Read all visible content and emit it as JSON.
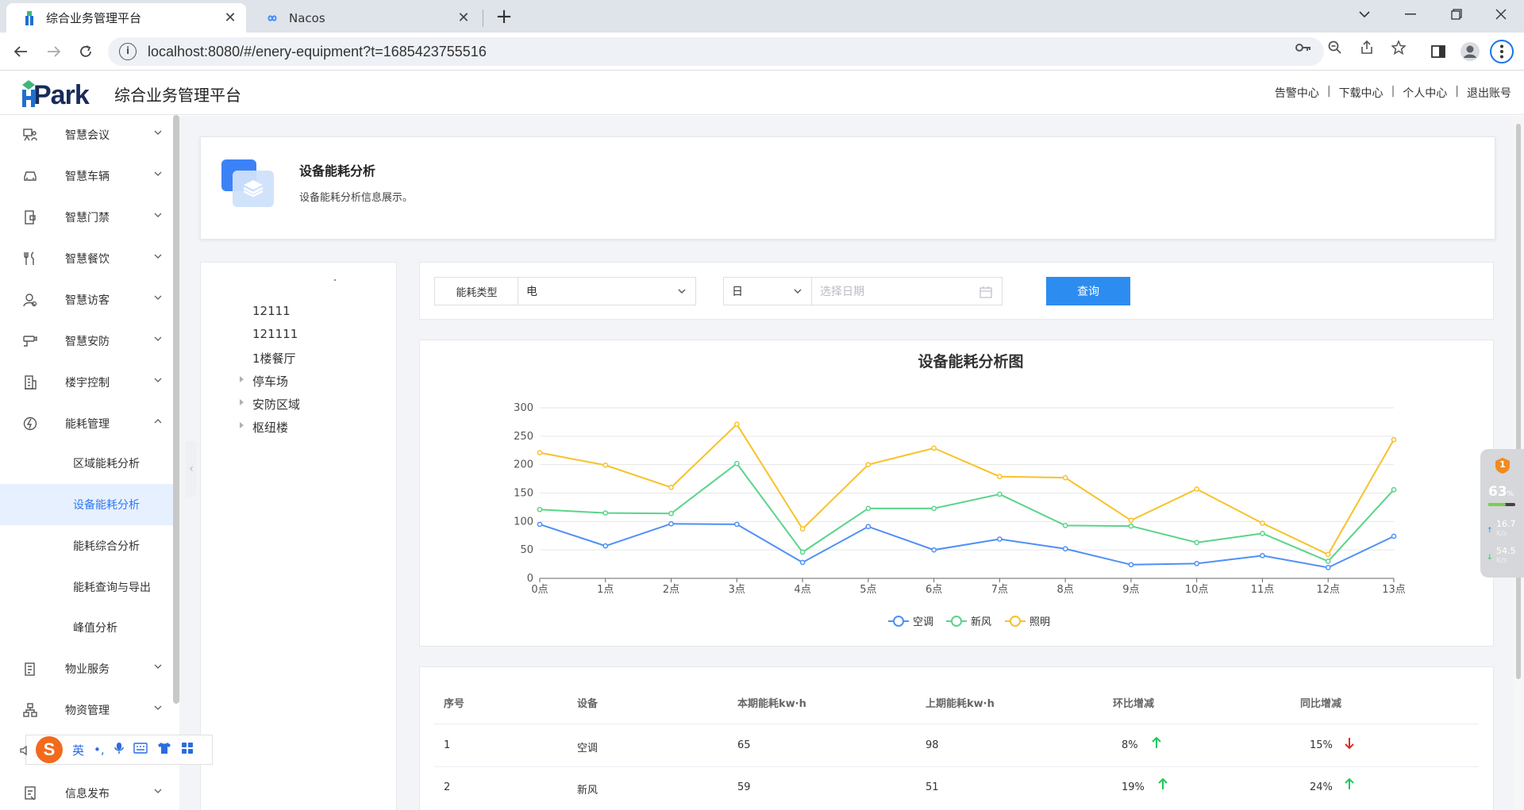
{
  "browser": {
    "tabs": [
      {
        "title": "综合业务管理平台",
        "active": true
      },
      {
        "title": "Nacos",
        "active": false
      }
    ],
    "url": "localhost:8080/#/enery-equipment?t=1685423755516"
  },
  "app": {
    "logo_text": "Park",
    "title": "综合业务管理平台",
    "top_links": [
      "告警中心",
      "下载中心",
      "个人中心",
      "退出账号"
    ]
  },
  "sidebar": {
    "items": [
      {
        "label": "智慧会议",
        "icon": "meeting-icon"
      },
      {
        "label": "智慧车辆",
        "icon": "car-icon"
      },
      {
        "label": "智慧门禁",
        "icon": "door-icon"
      },
      {
        "label": "智慧餐饮",
        "icon": "dining-icon"
      },
      {
        "label": "智慧访客",
        "icon": "visitor-icon"
      },
      {
        "label": "智慧安防",
        "icon": "camera-icon"
      },
      {
        "label": "楼宇控制",
        "icon": "building-icon"
      },
      {
        "label": "能耗管理",
        "icon": "energy-icon",
        "expanded": true
      }
    ],
    "sub_items": [
      {
        "label": "区域能耗分析",
        "active": false
      },
      {
        "label": "设备能耗分析",
        "active": true
      },
      {
        "label": "能耗综合分析",
        "active": false
      },
      {
        "label": "能耗查询与导出",
        "active": false
      },
      {
        "label": "峰值分析",
        "active": false
      }
    ],
    "items_after": [
      {
        "label": "物业服务",
        "icon": "property-icon"
      },
      {
        "label": "物资管理",
        "icon": "material-icon"
      },
      {
        "label": "信息发布",
        "icon": "publish-icon"
      }
    ]
  },
  "intro": {
    "title": "设备能耗分析",
    "description": "设备能耗分析信息展示。"
  },
  "tree": {
    "nodes": [
      {
        "label": "12111",
        "expandable": false
      },
      {
        "label": "121111",
        "expandable": false
      },
      {
        "label": "1楼餐厅",
        "expandable": false
      },
      {
        "label": "停车场",
        "expandable": true
      },
      {
        "label": "安防区域",
        "expandable": true
      },
      {
        "label": "枢纽楼",
        "expandable": true
      }
    ]
  },
  "filters": {
    "type_label": "能耗类型",
    "type_value": "电",
    "period_value": "日",
    "date_placeholder": "选择日期",
    "query_label": "查询"
  },
  "chart_data": {
    "type": "line",
    "title": "设备能耗分析图",
    "categories": [
      "0点",
      "1点",
      "2点",
      "3点",
      "4点",
      "5点",
      "6点",
      "7点",
      "8点",
      "9点",
      "10点",
      "11点",
      "12点",
      "13点"
    ],
    "series": [
      {
        "name": "空调",
        "color": "#4f8ff7",
        "values": [
          95,
          57,
          96,
          95,
          28,
          91,
          50,
          69,
          52,
          24,
          26,
          40,
          19,
          74
        ]
      },
      {
        "name": "新风",
        "color": "#5ad48a",
        "values": [
          121,
          115,
          114,
          202,
          46,
          123,
          123,
          148,
          93,
          92,
          63,
          79,
          30,
          156
        ]
      },
      {
        "name": "照明",
        "color": "#f7c22a",
        "values": [
          221,
          199,
          160,
          271,
          87,
          200,
          229,
          179,
          177,
          102,
          157,
          97,
          42,
          244
        ]
      }
    ],
    "ylim": [
      0,
      300
    ],
    "yticks": [
      0,
      50,
      100,
      150,
      200,
      250,
      300
    ],
    "grid": true,
    "legend_position": "bottom"
  },
  "table": {
    "headers": [
      "序号",
      "设备",
      "本期能耗kw·h",
      "上期能耗kw·h",
      "环比增减",
      "同比增减"
    ],
    "rows": [
      {
        "idx": "1",
        "device": "空调",
        "current": "65",
        "previous": "98",
        "mom": "8%",
        "mom_dir": "up",
        "yoy": "15%",
        "yoy_dir": "down"
      },
      {
        "idx": "2",
        "device": "新风",
        "current": "59",
        "previous": "51",
        "mom": "19%",
        "mom_dir": "up",
        "yoy": "24%",
        "yoy_dir": "up"
      }
    ]
  },
  "ime": {
    "logo": "S",
    "mode": "英",
    "punct": "•,"
  },
  "speed_widget": {
    "badge": "1",
    "percent": "63",
    "percent_unit": "%",
    "up_value": "16.7",
    "up_unit": "K/s",
    "down_value": "54.5",
    "down_unit": "K/s"
  },
  "colors": {
    "accent": "#2d8cf0",
    "up_arrow": "#1ec85a",
    "down_arrow": "#e02a2a"
  }
}
